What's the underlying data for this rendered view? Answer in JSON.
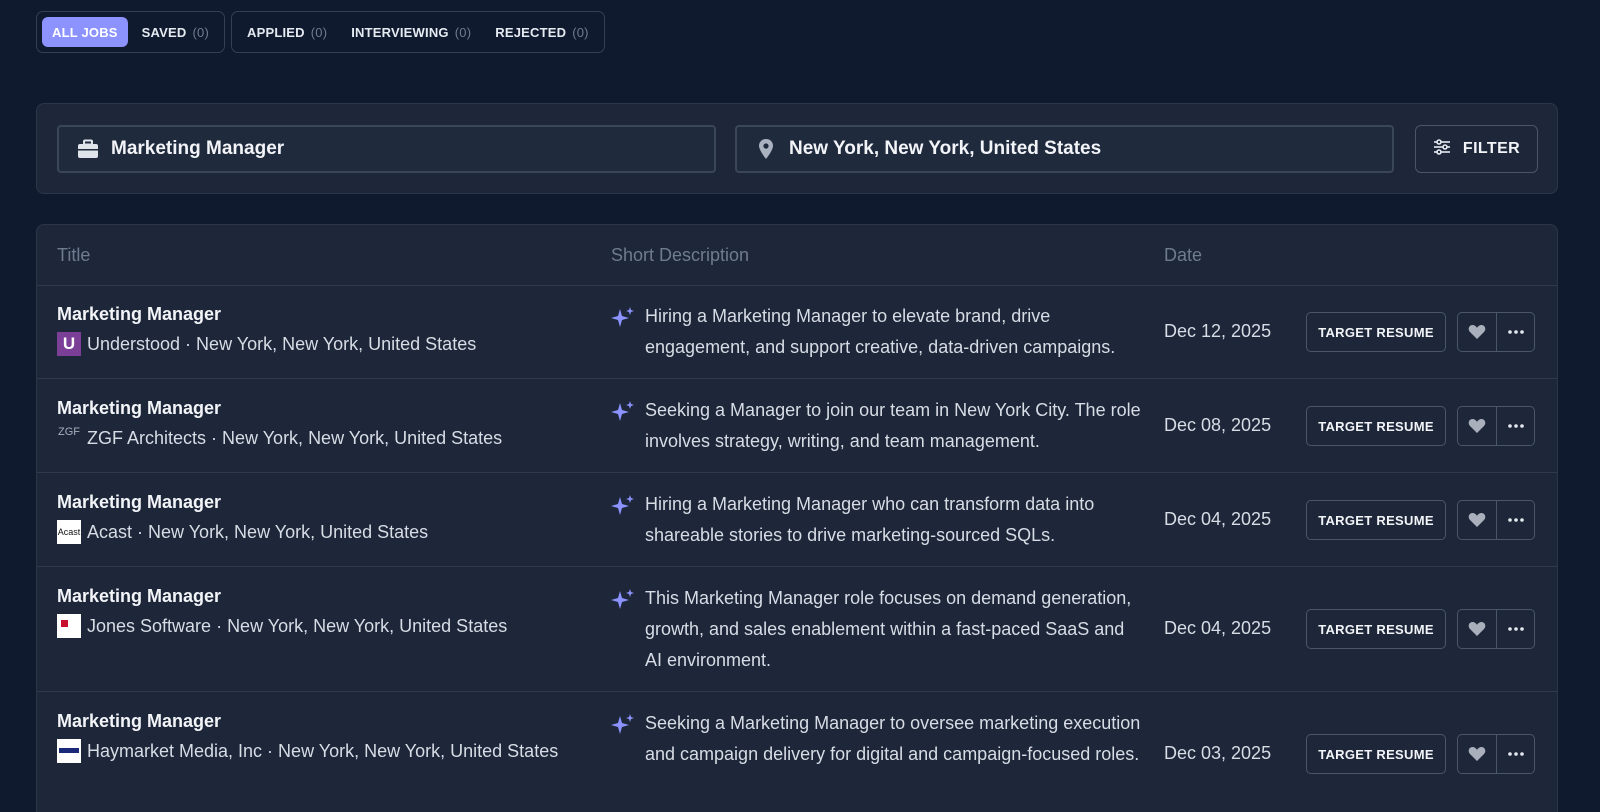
{
  "tabs": {
    "all_jobs": "ALL JOBS",
    "saved": "SAVED",
    "saved_count": "(0)",
    "applied": "APPLIED",
    "applied_count": "(0)",
    "interviewing": "INTERVIEWING",
    "interviewing_count": "(0)",
    "rejected": "REJECTED",
    "rejected_count": "(0)"
  },
  "search": {
    "keyword": "Marketing Manager",
    "location": "New York, New York, United States",
    "filter_label": "FILTER"
  },
  "table": {
    "headers": {
      "title": "Title",
      "description": "Short Description",
      "date": "Date"
    },
    "rows": [
      {
        "title": "Marketing Manager",
        "company": "Understood · New York, New York, United States",
        "logo_text": "U",
        "description": "Hiring a Marketing Manager to elevate brand, drive engagement, and support creative, data-driven campaigns.",
        "date": "Dec 12, 2025",
        "action": "TARGET RESUME"
      },
      {
        "title": "Marketing Manager",
        "company": "ZGF Architects · New York, New York, United States",
        "logo_text": "ZGF",
        "description": "Seeking a Manager to join our team in New York City. The role involves strategy, writing, and team management.",
        "date": "Dec 08, 2025",
        "action": "TARGET RESUME"
      },
      {
        "title": "Marketing Manager",
        "company": "Acast · New York, New York, United States",
        "logo_text": "Acast",
        "description": "Hiring a Marketing Manager who can transform data into shareable stories to drive marketing-sourced SQLs.",
        "date": "Dec 04, 2025",
        "action": "TARGET RESUME"
      },
      {
        "title": "Marketing Manager",
        "company": "Jones Software · New York, New York, United States",
        "logo_text": "",
        "description": "This Marketing Manager role focuses on demand generation, growth, and sales enablement within a fast-paced SaaS and AI environment.",
        "date": "Dec 04, 2025",
        "action": "TARGET RESUME"
      },
      {
        "title": "Marketing Manager",
        "company": "Haymarket Media, Inc · New York, New York, United States",
        "logo_text": "",
        "description": "Seeking a Marketing Manager to oversee marketing execution and campaign delivery for digital and campaign-focused roles.",
        "date": "Dec 03, 2025",
        "action": "TARGET RESUME"
      }
    ]
  },
  "colors": {
    "background": "#0f1a2e",
    "panel": "#1d2739",
    "accent": "#8c93ff"
  },
  "icons": [
    "briefcase-icon",
    "map-pin-icon",
    "sliders-icon",
    "sparkle-icon",
    "heart-icon",
    "more-icon"
  ]
}
